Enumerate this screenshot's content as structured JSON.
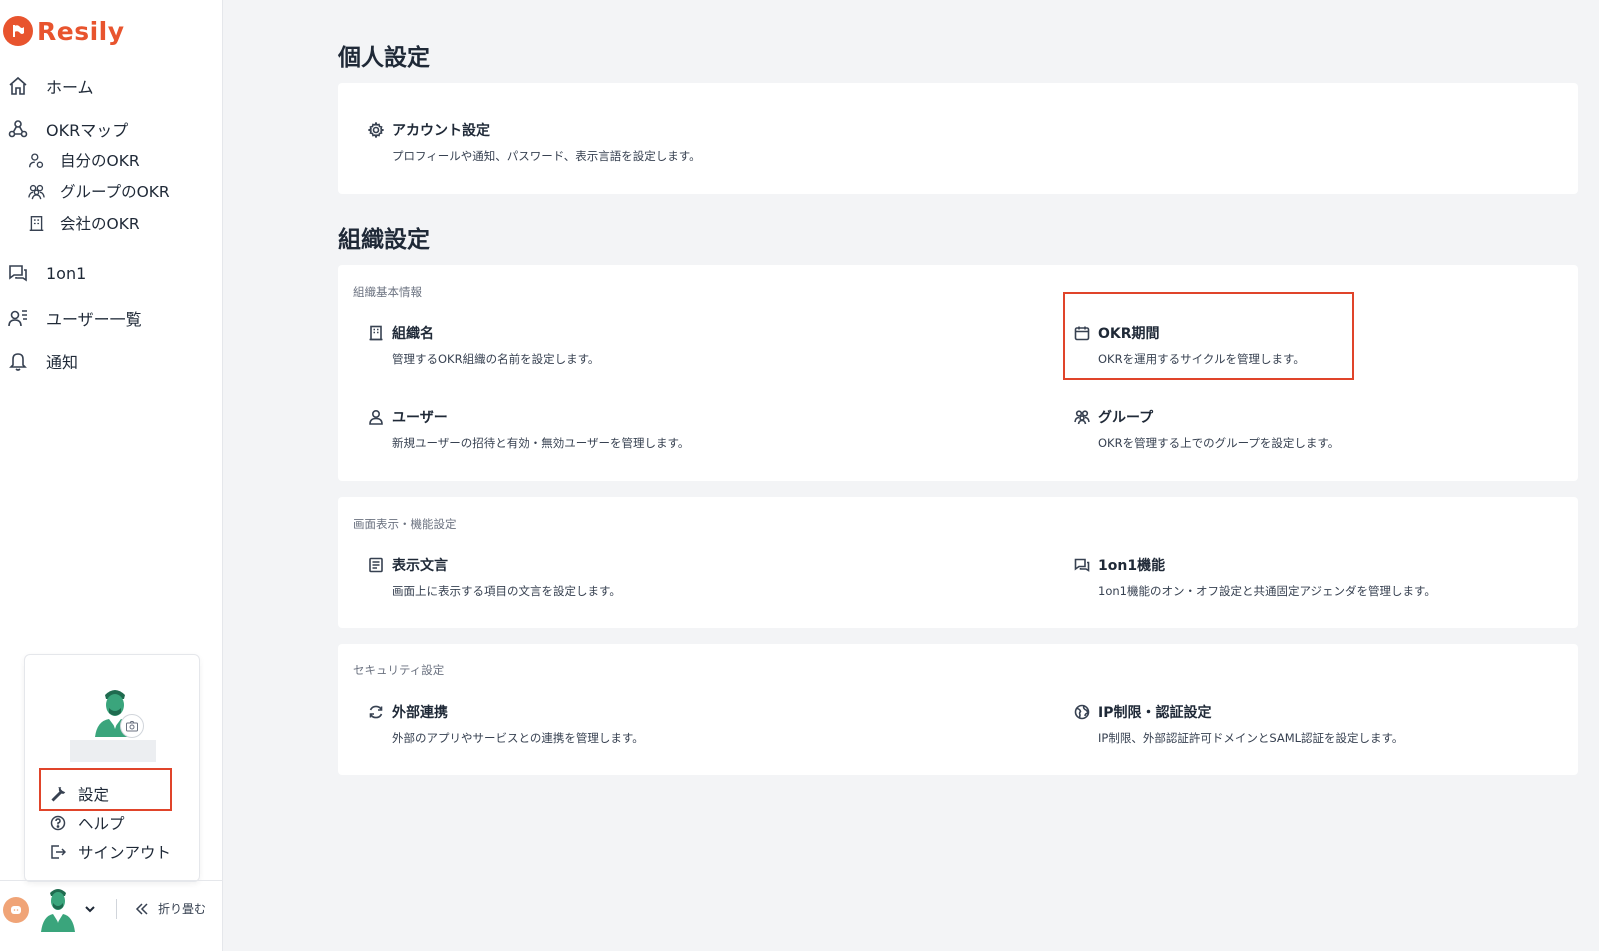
{
  "brand": {
    "name": "Resily",
    "color": "#e8542e"
  },
  "sidebar": {
    "nav": [
      {
        "label": "ホーム",
        "icon": "home-icon"
      },
      {
        "label": "OKRマップ",
        "icon": "okr-map-icon"
      },
      {
        "label": "自分のOKR",
        "icon": "user-okr-icon"
      },
      {
        "label": "グループのOKR",
        "icon": "group-icon"
      },
      {
        "label": "会社のOKR",
        "icon": "building-icon"
      },
      {
        "label": "1on1",
        "icon": "chat-icon"
      },
      {
        "label": "ユーザー一覧",
        "icon": "users-list-icon"
      },
      {
        "label": "通知",
        "icon": "bell-icon"
      }
    ],
    "popup": {
      "items": [
        {
          "label": "設定",
          "icon": "wrench-icon"
        },
        {
          "label": "ヘルプ",
          "icon": "help-icon"
        },
        {
          "label": "サインアウト",
          "icon": "signout-icon"
        }
      ]
    },
    "collapse_label": "折り畳む"
  },
  "personal": {
    "title": "個人設定",
    "account": {
      "title": "アカウント設定",
      "desc": "プロフィールや通知、パスワード、表示言語を設定します。",
      "icon": "gear-icon"
    }
  },
  "org": {
    "title": "組織設定",
    "basic": {
      "label": "組織基本情報",
      "items": [
        {
          "title": "組織名",
          "desc": "管理するOKR組織の名前を設定します。",
          "icon": "building-icon"
        },
        {
          "title": "OKR期間",
          "desc": "OKRを運用するサイクルを管理します。",
          "icon": "calendar-icon"
        },
        {
          "title": "ユーザー",
          "desc": "新規ユーザーの招待と有効・無効ユーザーを管理します。",
          "icon": "user-icon"
        },
        {
          "title": "グループ",
          "desc": "OKRを管理する上でのグループを設定します。",
          "icon": "group-icon"
        }
      ]
    },
    "display": {
      "label": "画面表示・機能設定",
      "items": [
        {
          "title": "表示文言",
          "desc": "画面上に表示する項目の文言を設定します。",
          "icon": "document-icon"
        },
        {
          "title": "1on1機能",
          "desc": "1on1機能のオン・オフ設定と共通固定アジェンダを管理します。",
          "icon": "chat-icon"
        }
      ]
    },
    "security": {
      "label": "セキュリティ設定",
      "items": [
        {
          "title": "外部連携",
          "desc": "外部のアプリやサービスとの連携を管理します。",
          "icon": "sync-icon"
        },
        {
          "title": "IP制限・認証設定",
          "desc": "IP制限、外部認証許可ドメインとSAML認証を設定します。",
          "icon": "globe-icon"
        }
      ]
    }
  }
}
